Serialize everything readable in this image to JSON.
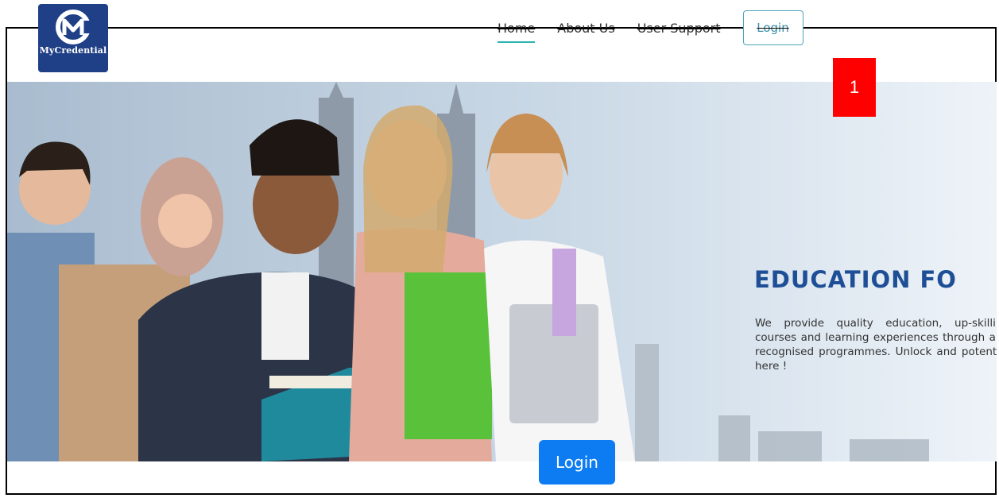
{
  "brand": {
    "name": "MyCredential"
  },
  "nav": {
    "links": [
      {
        "label": "Home",
        "active": true
      },
      {
        "label": "About Us",
        "active": false
      },
      {
        "label": "User Support",
        "active": false
      }
    ],
    "login_label": "Login"
  },
  "hero": {
    "title": "EDUCATION FO",
    "description": "We provide quality education, up-skilling courses and learning experiences through and recognised programmes. Unlock and potential here !"
  },
  "annotation": {
    "marker": "1"
  },
  "cta": {
    "login_label": "Login"
  },
  "colors": {
    "brand": "#1f3f86",
    "accent": "#2bb3b3",
    "primary_button": "#0d7cf2",
    "annotation": "#ff0000",
    "hero_title": "#1e4f96"
  }
}
